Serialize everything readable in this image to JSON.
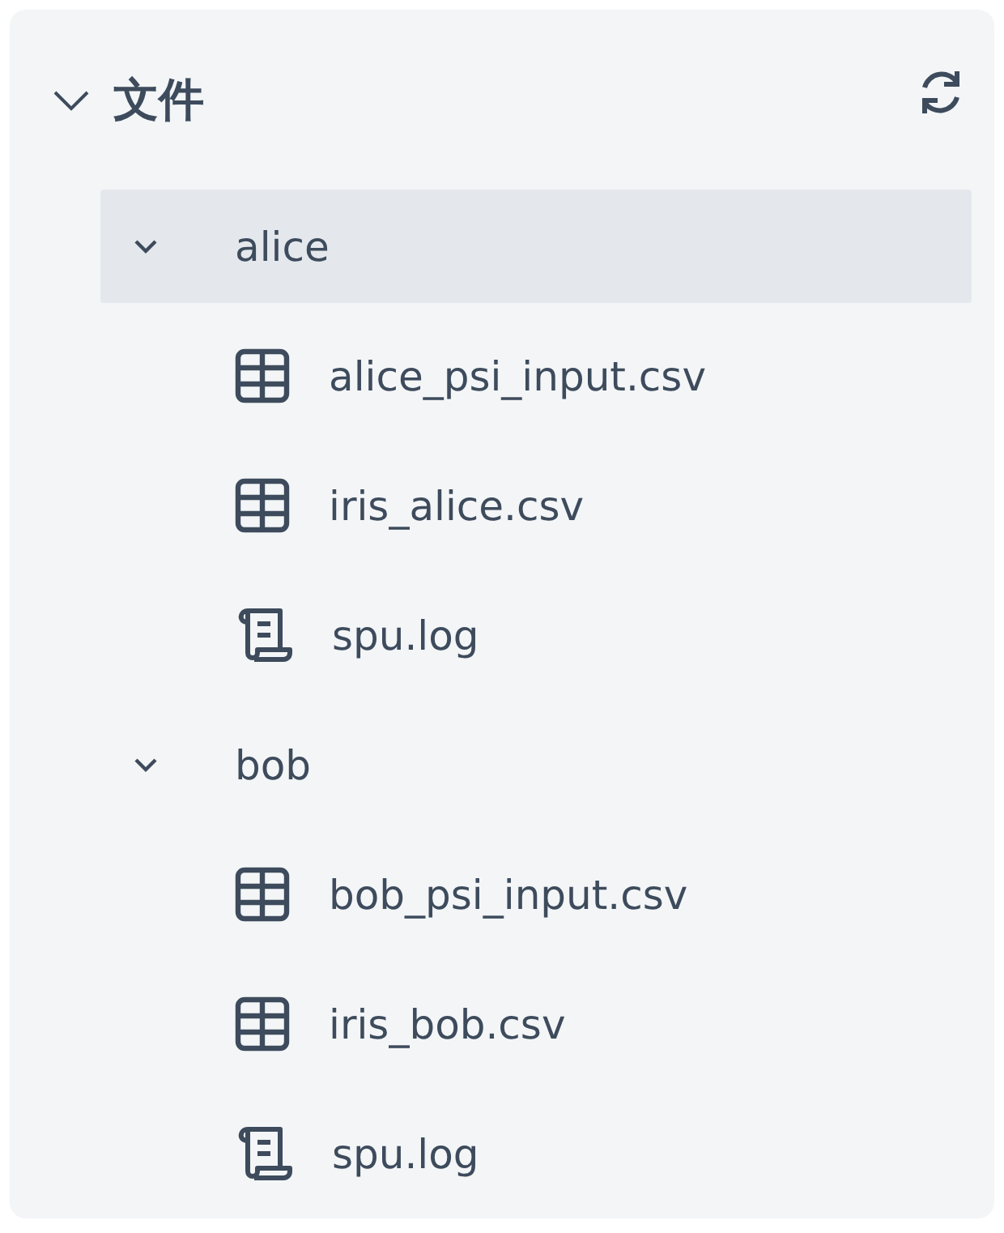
{
  "panel": {
    "title": "文件",
    "expanded": true
  },
  "tree": [
    {
      "label": "alice",
      "kind": "folder",
      "expanded": true,
      "selected": true,
      "children": [
        {
          "label": "alice_psi_input.csv",
          "kind": "table",
          "selected": false
        },
        {
          "label": "iris_alice.csv",
          "kind": "table",
          "selected": false
        },
        {
          "label": "spu.log",
          "kind": "log",
          "selected": false
        }
      ]
    },
    {
      "label": "bob",
      "kind": "folder",
      "expanded": true,
      "selected": false,
      "children": [
        {
          "label": "bob_psi_input.csv",
          "kind": "table",
          "selected": false
        },
        {
          "label": "iris_bob.csv",
          "kind": "table",
          "selected": false
        },
        {
          "label": "spu.log",
          "kind": "log",
          "selected": false
        }
      ]
    }
  ]
}
